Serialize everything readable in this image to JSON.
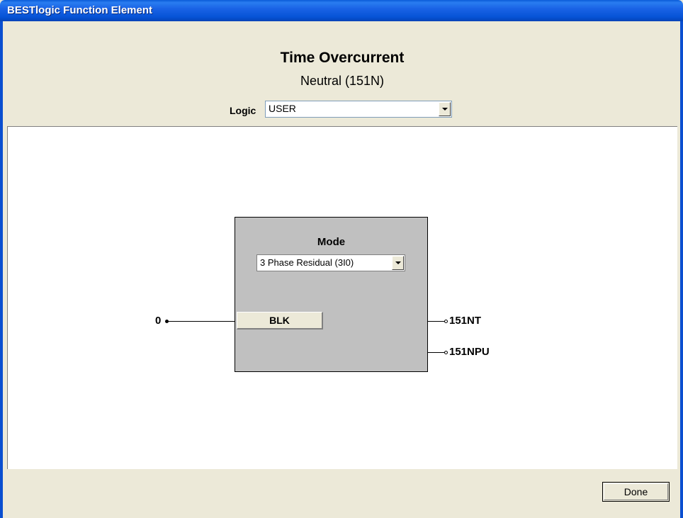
{
  "window": {
    "title": "BESTlogic Function Element"
  },
  "header": {
    "title": "Time Overcurrent",
    "subtitle": "Neutral (151N)",
    "logic_label": "Logic",
    "logic_value": "USER"
  },
  "block": {
    "mode_label": "Mode",
    "mode_value": "3 Phase Residual (3I0)",
    "blk_label": "BLK"
  },
  "signals": {
    "input_value": "0",
    "output_1": "151NT",
    "output_2": "151NPU"
  },
  "footer": {
    "done_label": "Done"
  }
}
